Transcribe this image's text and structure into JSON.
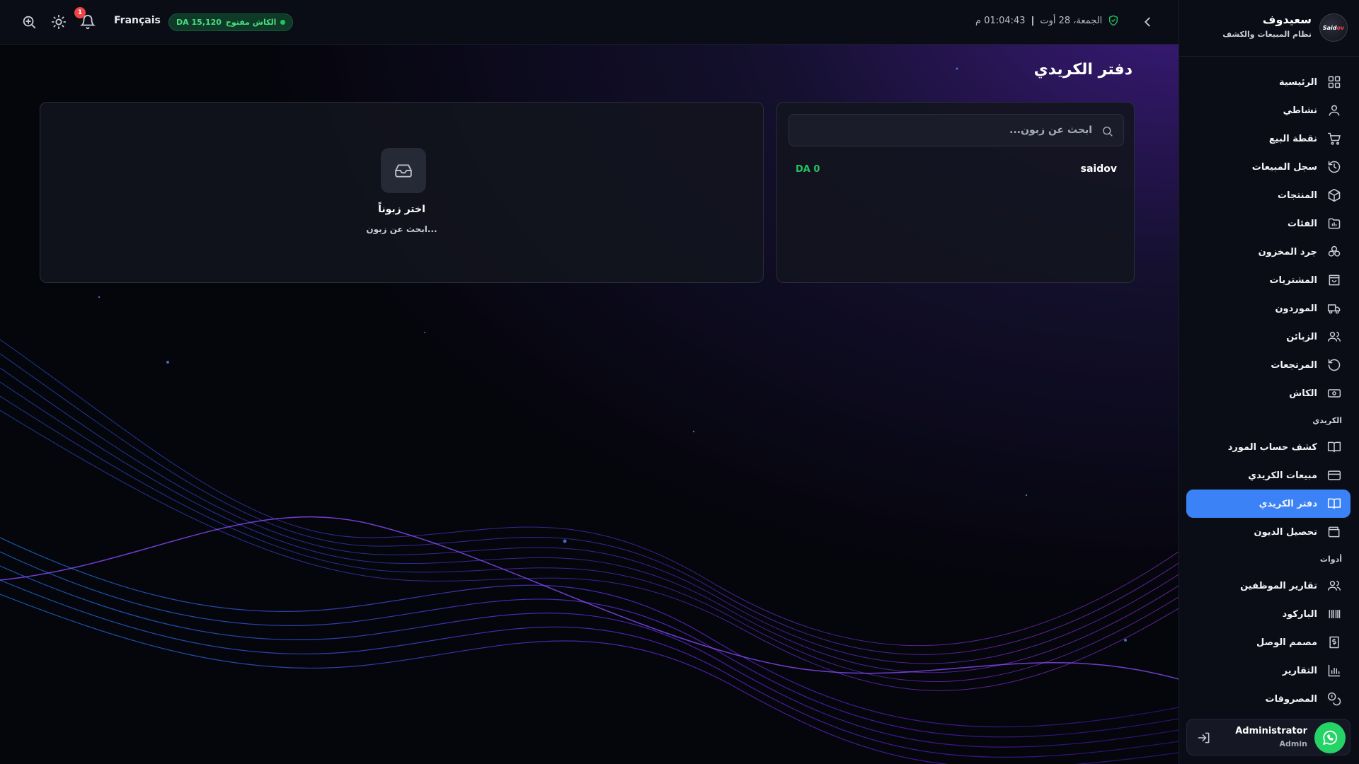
{
  "topbar": {
    "language": "Français",
    "cash_status": "الكاش مفتوح",
    "cash_amount": "DA 15,120",
    "notifications_count": "1",
    "date": "الجمعة، 28 أوت",
    "time": "01:04:43 م",
    "icons": [
      "zoom-in-icon",
      "sun-icon",
      "bell-icon",
      "shield-check-icon",
      "chevron-left-icon"
    ]
  },
  "page": {
    "title": "دفتر الكريدي"
  },
  "customers_panel": {
    "search_placeholder": "ابحث عن زبون...",
    "customers": [
      {
        "name": "saidov",
        "balance": "DA 0"
      }
    ]
  },
  "detail_panel": {
    "empty_title": "اختر زبوناً",
    "empty_subtitle": "ابحث عن زبون..."
  },
  "sidebar": {
    "brand_name": "سعيدوف",
    "brand_subtitle": "نظام المبيعات والكشف",
    "logo_text_a": "Said",
    "logo_text_b": "ov",
    "items_main": [
      {
        "label": "الرئيسية",
        "icon": "grid-icon"
      },
      {
        "label": "نشاطي",
        "icon": "user-icon"
      },
      {
        "label": "نقطة البيع",
        "icon": "cart-icon"
      },
      {
        "label": "سجل المبيعات",
        "icon": "history-icon"
      },
      {
        "label": "المنتجات",
        "icon": "box-icon"
      },
      {
        "label": "الفئات",
        "icon": "folder-icon"
      },
      {
        "label": "جرد المخزون",
        "icon": "boxes-icon"
      },
      {
        "label": "المشتريات",
        "icon": "shopping-bag-icon"
      },
      {
        "label": "الموردون",
        "icon": "truck-icon"
      },
      {
        "label": "الزبائن",
        "icon": "users-icon"
      },
      {
        "label": "المرتجعات",
        "icon": "rotate-ccw-icon"
      },
      {
        "label": "الكاش",
        "icon": "banknote-icon"
      }
    ],
    "section_credit": "الكريدي",
    "items_credit": [
      {
        "label": "كشف حساب المورد",
        "icon": "book-icon"
      },
      {
        "label": "مبيعات الكريدي",
        "icon": "credit-card-icon"
      },
      {
        "label": "دفتر الكريدي",
        "icon": "book-open-icon"
      },
      {
        "label": "تحصيل الديون",
        "icon": "wallet-icon"
      }
    ],
    "section_tools": "أدوات",
    "items_tools": [
      {
        "label": "تقارير الموظفين",
        "icon": "users-icon"
      },
      {
        "label": "الباركود",
        "icon": "barcode-icon"
      },
      {
        "label": "مصمم الوصل",
        "icon": "receipt-icon"
      },
      {
        "label": "التقارير",
        "icon": "bar-chart-icon"
      },
      {
        "label": "المصروفات",
        "icon": "coins-icon"
      }
    ],
    "user_name": "Administrator",
    "user_role": "Admin"
  }
}
